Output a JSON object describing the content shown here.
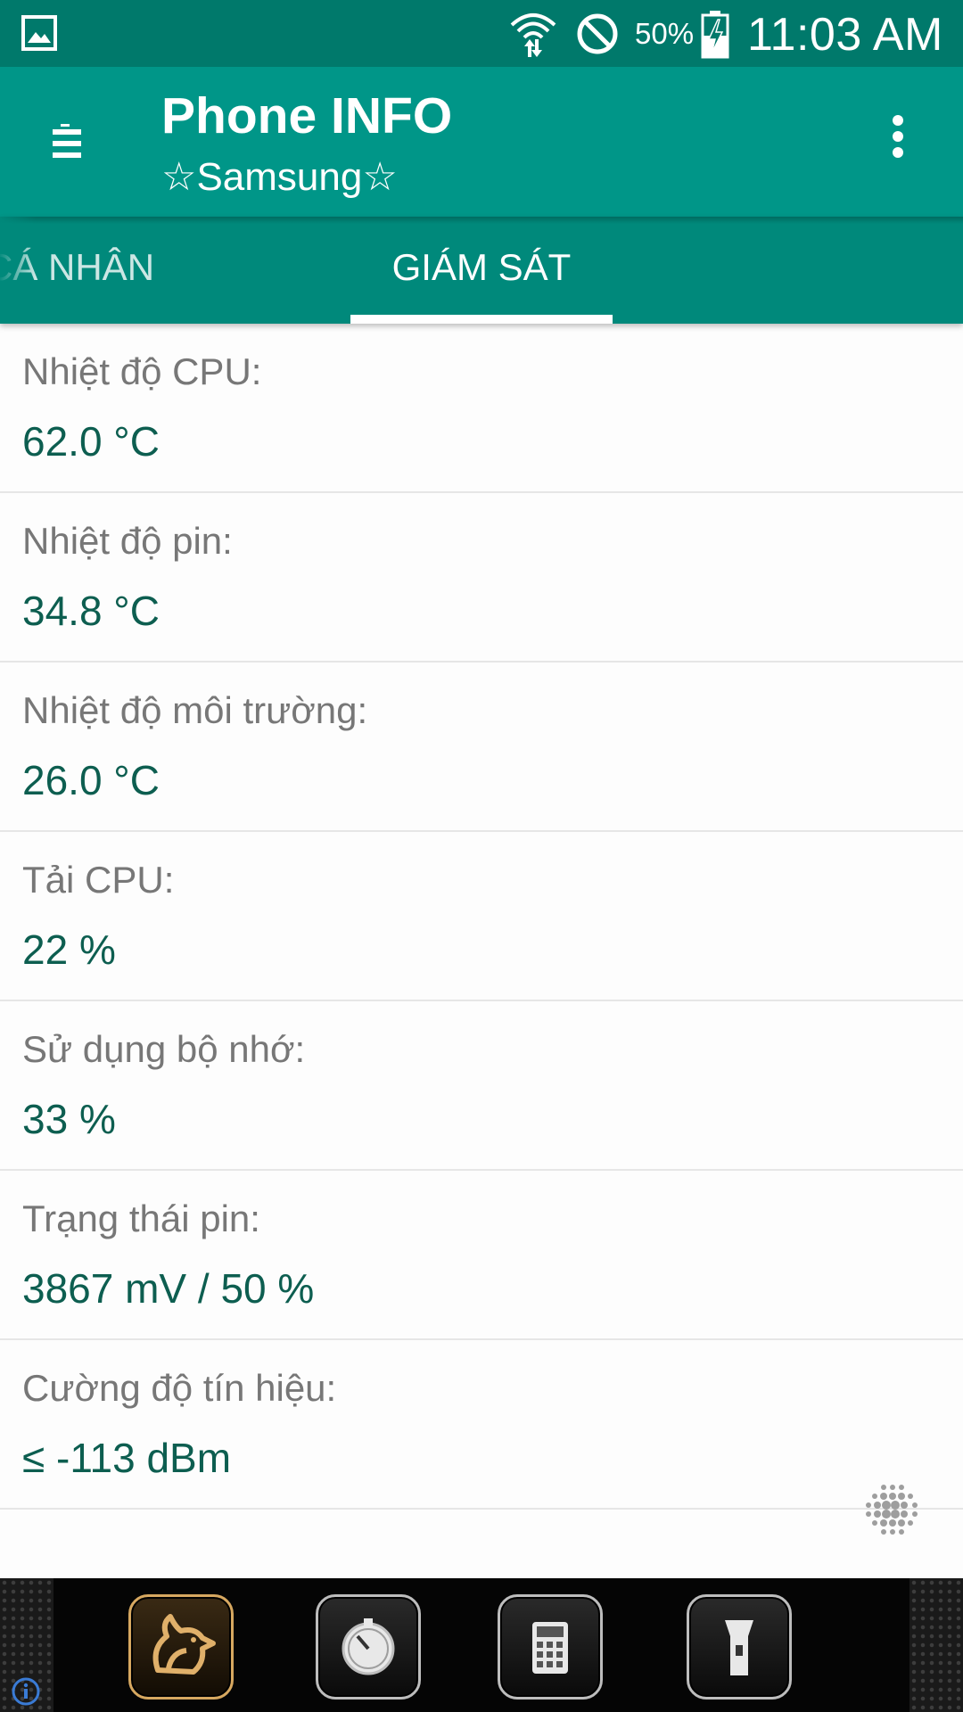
{
  "status_bar": {
    "battery_percent": "50%",
    "time": "11:03 AM",
    "icons": [
      "gallery-icon",
      "wifi-icon",
      "do-not-disturb-icon",
      "battery-charging-icon"
    ]
  },
  "app_bar": {
    "title": "Phone INFO",
    "subtitle": "☆Samsung☆",
    "icons": [
      "menu-icon",
      "overflow-menu-icon"
    ]
  },
  "tabs": [
    {
      "label": "CÁ NHÂN",
      "active": false
    },
    {
      "label": "GIÁM SÁT",
      "active": true
    }
  ],
  "metrics": [
    {
      "label": "Nhiệt độ CPU:",
      "value": "62.0 °C"
    },
    {
      "label": "Nhiệt độ pin:",
      "value": "34.8 °C"
    },
    {
      "label": "Nhiệt độ môi trường:",
      "value": "26.0 °C"
    },
    {
      "label": "Tải CPU:",
      "value": "22 %"
    },
    {
      "label": "Sử dụng bộ nhớ:",
      "value": "33 %"
    },
    {
      "label": "Trạng thái pin:",
      "value": "3867 mV / 50 %"
    },
    {
      "label": "Cường độ tín hiệu:",
      "value": "≤ -113 dBm"
    }
  ],
  "dock": {
    "icons": [
      "uc-browser-icon",
      "stopwatch-icon",
      "calculator-icon",
      "flashlight-icon"
    ]
  },
  "colors": {
    "status_bar": "#00796b",
    "app_bar": "#009688",
    "tab_bar": "#00897b",
    "value_text": "#0d5e50",
    "label_text": "#777777"
  }
}
